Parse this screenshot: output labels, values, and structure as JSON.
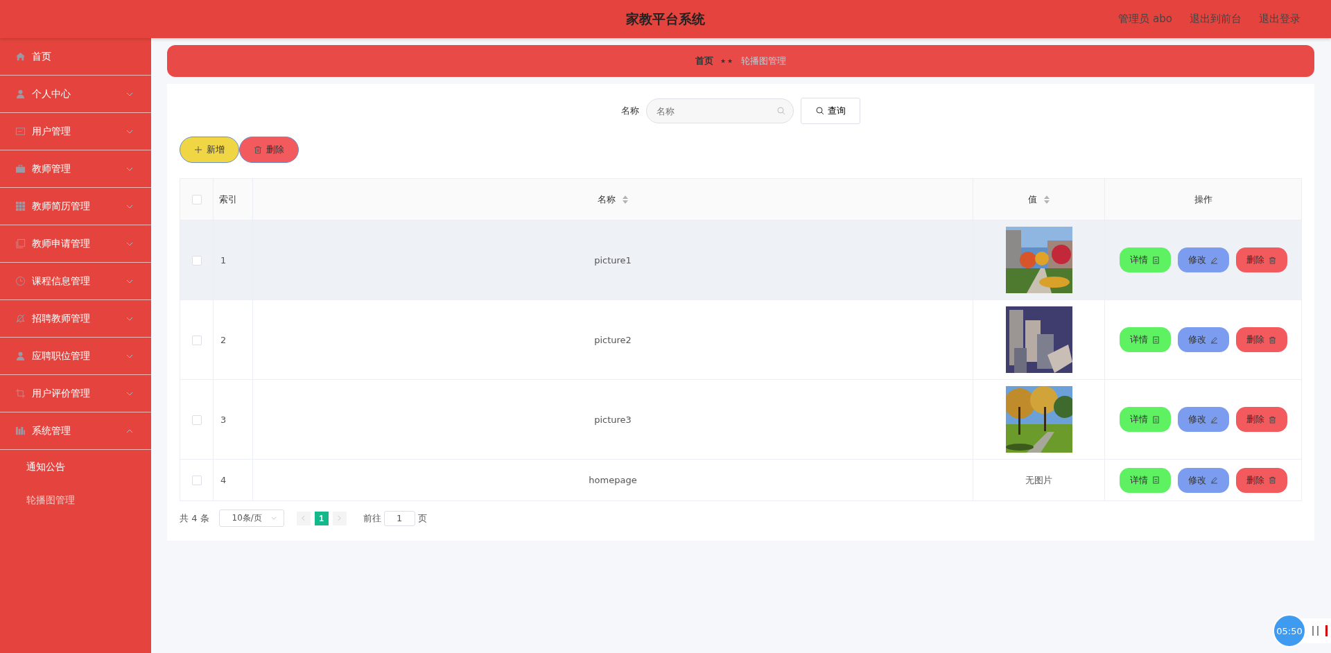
{
  "header": {
    "title": "家教平台系统",
    "links": [
      "管理员 abo",
      "退出到前台",
      "退出登录"
    ]
  },
  "sidebar": {
    "items": [
      {
        "label": "首页"
      },
      {
        "label": "个人中心",
        "expanded": false
      },
      {
        "label": "用户管理",
        "expanded": false
      },
      {
        "label": "教师管理",
        "expanded": false
      },
      {
        "label": "教师简历管理",
        "expanded": false
      },
      {
        "label": "教师申请管理",
        "expanded": false
      },
      {
        "label": "课程信息管理",
        "expanded": false
      },
      {
        "label": "招聘教师管理",
        "expanded": false
      },
      {
        "label": "应聘职位管理",
        "expanded": false
      },
      {
        "label": "用户评价管理",
        "expanded": false
      },
      {
        "label": "系统管理",
        "expanded": true,
        "children": [
          {
            "label": "通知公告",
            "selected": false
          },
          {
            "label": "轮播图管理",
            "selected": true
          }
        ]
      }
    ]
  },
  "breadcrumb": {
    "items": [
      "首页",
      "轮播图管理"
    ],
    "separator": "★★"
  },
  "search": {
    "label": "名称",
    "placeholder": "名称",
    "button": "查询"
  },
  "actions": {
    "add": "新增",
    "delete": "删除"
  },
  "table": {
    "all_checked": false,
    "columns": [
      {
        "label": "索引",
        "sortable": false
      },
      {
        "label": "名称",
        "sortable": true
      },
      {
        "label": "值",
        "sortable": true
      },
      {
        "label": "操作",
        "sortable": false
      }
    ],
    "rows": [
      {
        "checked": false,
        "highlighted": true,
        "index": "1",
        "name": "picture1",
        "value": {
          "kind": "picture"
        },
        "buttons": [
          "详情",
          "修改",
          "删除"
        ]
      },
      {
        "checked": false,
        "highlighted": false,
        "index": "2",
        "name": "picture2",
        "value": {
          "kind": "picture"
        },
        "buttons": [
          "详情",
          "修改",
          "删除"
        ]
      },
      {
        "checked": false,
        "highlighted": false,
        "index": "3",
        "name": "picture3",
        "value": {
          "kind": "picture"
        },
        "buttons": [
          "详情",
          "修改",
          "删除"
        ]
      },
      {
        "checked": false,
        "highlighted": false,
        "index": "4",
        "name": "homepage",
        "value": {
          "kind": "text",
          "text": "无图片"
        },
        "buttons": [
          "详情",
          "修改",
          "删除"
        ]
      }
    ]
  },
  "pagination": {
    "total": "共 4 条",
    "page_size": "10条/页",
    "pages": [
      {
        "label": "1",
        "selected": true
      }
    ],
    "goto_label": "前往",
    "goto_value": "1",
    "goto_suffix": "页"
  },
  "timer": {
    "time": "05:50"
  }
}
